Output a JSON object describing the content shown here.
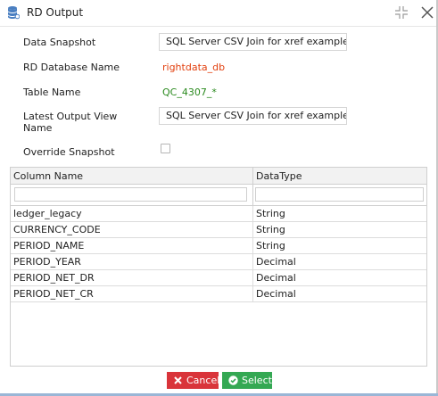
{
  "dialog": {
    "title": "RD Output",
    "icon": "database-icon"
  },
  "form": {
    "data_snapshot_label": "Data Snapshot",
    "data_snapshot_value": "SQL Server CSV Join for xref example",
    "rd_database_name_label": "RD Database Name",
    "rd_database_name_value": "rightdata_db",
    "table_name_label": "Table Name",
    "table_name_value": "QC_4307_*",
    "latest_output_view_label_line1": "Latest Output View",
    "latest_output_view_label_line2": "Name",
    "latest_output_view_value": "SQL Server CSV Join for xref example",
    "override_snapshot_label": "Override Snapshot",
    "override_snapshot_checked": false
  },
  "grid": {
    "columns": [
      "Column Name",
      "DataType"
    ],
    "rows": [
      {
        "name": "ledger_legacy",
        "type": "String"
      },
      {
        "name": "CURRENCY_CODE",
        "type": "String"
      },
      {
        "name": "PERIOD_NAME",
        "type": "String"
      },
      {
        "name": "PERIOD_YEAR",
        "type": "Decimal"
      },
      {
        "name": "PERIOD_NET_DR",
        "type": "Decimal"
      },
      {
        "name": "PERIOD_NET_CR",
        "type": "Decimal"
      }
    ]
  },
  "footer": {
    "cancel_label": "Cancel",
    "select_label": "Select"
  },
  "colors": {
    "cancel": "#d9343a",
    "select": "#34a853",
    "database_value": "#e2400f",
    "table_value": "#2a8a1e"
  }
}
